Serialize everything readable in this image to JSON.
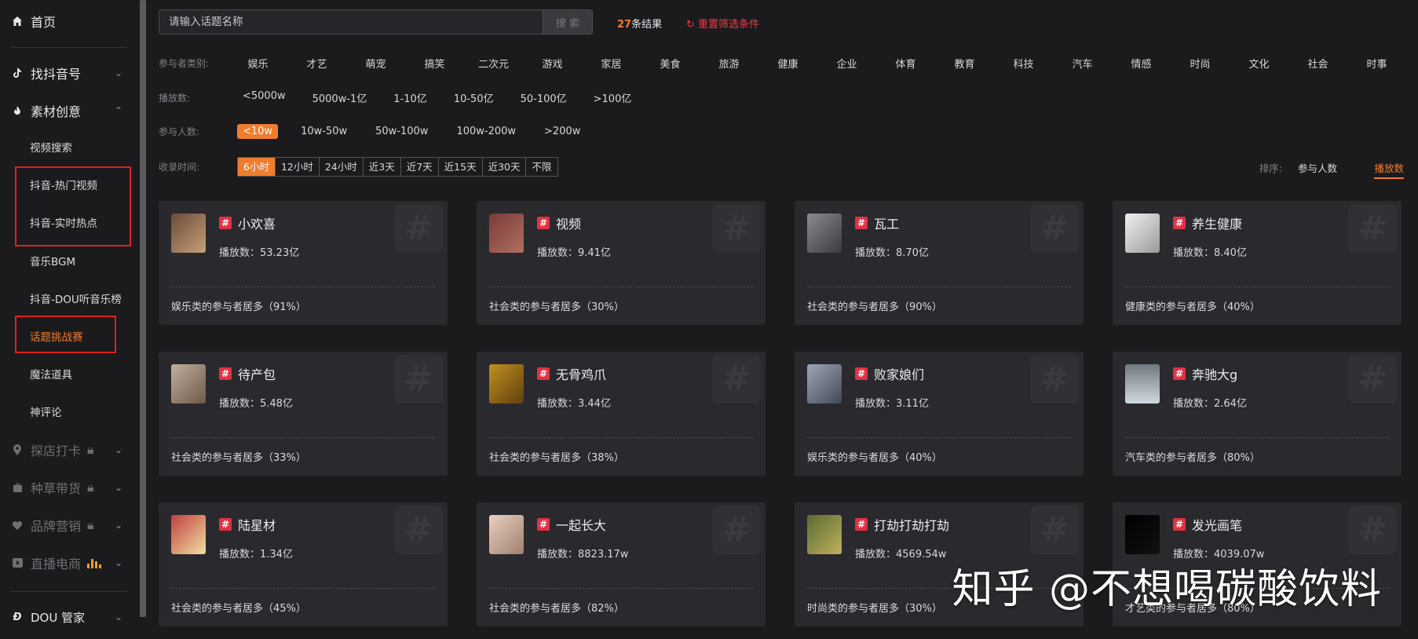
{
  "sidebar": {
    "home": "首页",
    "music": "找抖音号",
    "material": "素材创意",
    "sub_items": [
      "视频搜索",
      "抖音-热门视频",
      "抖音-实时热点",
      "音乐BGM",
      "抖音-DOU听音乐榜",
      "话题挑战赛",
      "魔法道具",
      "神评论"
    ],
    "locked": [
      "探店打卡",
      "种草带货",
      "品牌营销",
      "直播电商"
    ],
    "dou_manager": "DOU 管家"
  },
  "search": {
    "placeholder": "请输入话题名称",
    "button": "搜 索"
  },
  "results": {
    "count": "27",
    "suffix": "条结果",
    "reset": "重置筛选条件"
  },
  "filters": {
    "category": {
      "label": "参与者类别:",
      "options": [
        "娱乐",
        "才艺",
        "萌宠",
        "搞笑",
        "二次元",
        "游戏",
        "家居",
        "美食",
        "旅游",
        "健康",
        "企业",
        "体育",
        "教育",
        "科技",
        "汽车",
        "情感",
        "时尚",
        "文化",
        "社会",
        "时事"
      ]
    },
    "plays": {
      "label": "播放数:",
      "options": [
        "<5000w",
        "5000w-1亿",
        "1-10亿",
        "10-50亿",
        "50-100亿",
        ">100亿"
      ]
    },
    "participants": {
      "label": "参与人数:",
      "options": [
        "<10w",
        "10w-50w",
        "50w-100w",
        "100w-200w",
        ">200w"
      ],
      "selected": "<10w"
    },
    "time": {
      "label": "收录时间:",
      "options": [
        "6小时",
        "12小时",
        "24小时",
        "近3天",
        "近7天",
        "近15天",
        "近30天",
        "不限"
      ],
      "selected": "6小时"
    }
  },
  "sort": {
    "label": "排序:",
    "participants": "参与人数",
    "plays": "播放数"
  },
  "cards": [
    {
      "title": "小欢喜",
      "plays": "播放数：53.23亿",
      "footer": "娱乐类的参与者居多（91%）"
    },
    {
      "title": "视频",
      "plays": "播放数：9.41亿",
      "footer": "社会类的参与者居多（30%）"
    },
    {
      "title": "瓦工",
      "plays": "播放数：8.70亿",
      "footer": "社会类的参与者居多（90%）"
    },
    {
      "title": "养生健康",
      "plays": "播放数：8.40亿",
      "footer": "健康类的参与者居多（40%）"
    },
    {
      "title": "待产包",
      "plays": "播放数：5.48亿",
      "footer": "社会类的参与者居多（33%）"
    },
    {
      "title": "无骨鸡爪",
      "plays": "播放数：3.44亿",
      "footer": "社会类的参与者居多（38%）"
    },
    {
      "title": "败家娘们",
      "plays": "播放数：3.11亿",
      "footer": "娱乐类的参与者居多（40%）"
    },
    {
      "title": "奔驰大g",
      "plays": "播放数：2.64亿",
      "footer": "汽车类的参与者居多（80%）"
    },
    {
      "title": "陆星材",
      "plays": "播放数：1.34亿",
      "footer": "社会类的参与者居多（45%）"
    },
    {
      "title": "一起长大",
      "plays": "播放数：8823.17w",
      "footer": "社会类的参与者居多（82%）"
    },
    {
      "title": "打劫打劫打劫",
      "plays": "播放数：4569.54w",
      "footer": "时尚类的参与者居多（30%）"
    },
    {
      "title": "发光画笔",
      "plays": "播放数：4039.07w",
      "footer": "才艺类的参与者居多（80%）"
    }
  ],
  "colors": {
    "accent": "#f07c2e",
    "danger": "#e02020",
    "tag": "#e23045"
  },
  "watermark": "知乎 @不想喝碳酸饮料"
}
